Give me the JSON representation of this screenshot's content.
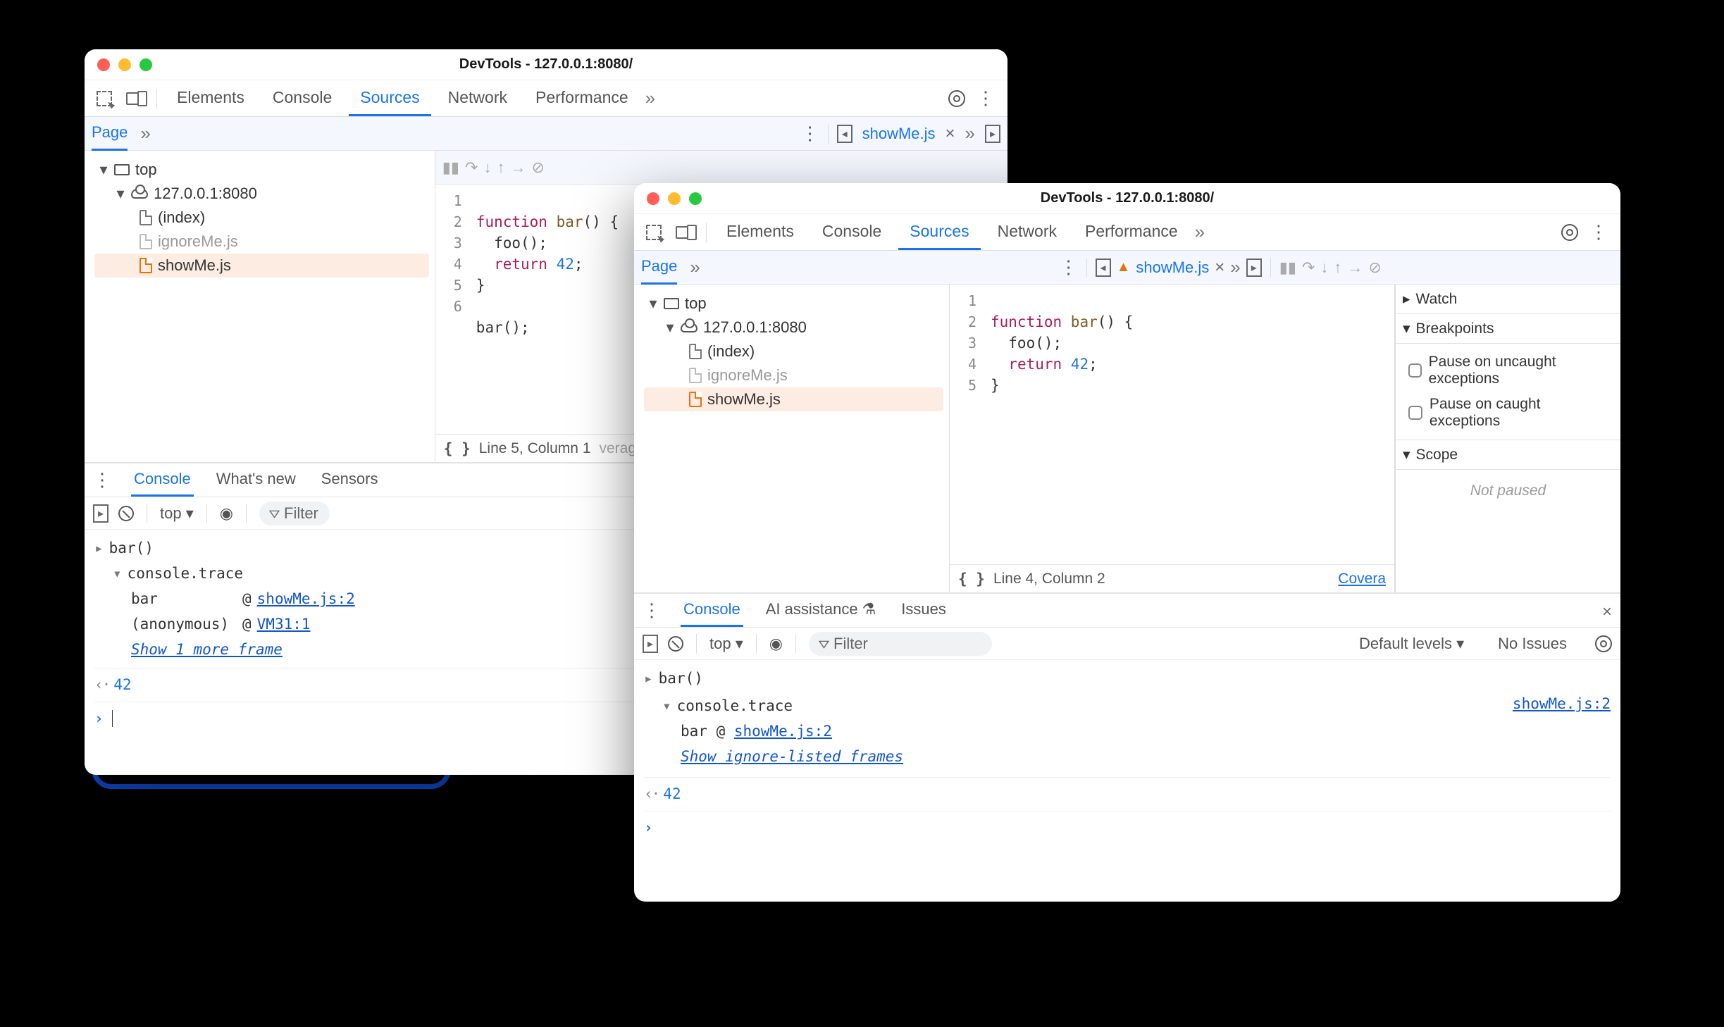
{
  "left": {
    "title": "DevTools - 127.0.0.1:8080/",
    "tabs": {
      "elements": "Elements",
      "console": "Console",
      "sources": "Sources",
      "network": "Network",
      "performance": "Performance",
      "active": "Sources"
    },
    "subbar": {
      "page": "Page",
      "openFile": "showMe.js"
    },
    "tree": {
      "top": "top",
      "origin": "127.0.0.1:8080",
      "index": "(index)",
      "ignore": "ignoreMe.js",
      "show": "showMe.js"
    },
    "code": {
      "lines": [
        "1",
        "2",
        "3",
        "4",
        "5",
        "6"
      ],
      "l1a": "function ",
      "l1b": "bar",
      "l1c": "() {",
      "l2": "  foo();",
      "l3a": "  ",
      "l3b": "return ",
      "l3c": "42",
      "l3d": ";",
      "l4": "}",
      "l5": "",
      "l6": "bar();"
    },
    "status": {
      "pretty": "{ }",
      "pos": "Line 5, Column 1",
      "extra": "verage:"
    },
    "drawerTabs": {
      "console": "Console",
      "whatsnew": "What's new",
      "sensors": "Sensors",
      "active": "Console"
    },
    "filter": {
      "ctx": "top ▾",
      "placeholder": "Filter"
    },
    "console": {
      "call": "bar()",
      "trace": "console.trace",
      "framebar": "bar",
      "frameanon": "(anonymous)",
      "at": "@",
      "loc1": "showMe.js:2",
      "loc2": "VM31:1",
      "showmore": "Show 1 more frame",
      "ret": "42"
    }
  },
  "right": {
    "title": "DevTools - 127.0.0.1:8080/",
    "tabs": {
      "elements": "Elements",
      "console": "Console",
      "sources": "Sources",
      "network": "Network",
      "performance": "Performance",
      "active": "Sources"
    },
    "subbar": {
      "page": "Page",
      "openFile": "showMe.js"
    },
    "tree": {
      "top": "top",
      "origin": "127.0.0.1:8080",
      "index": "(index)",
      "ignore": "ignoreMe.js",
      "show": "showMe.js"
    },
    "code": {
      "lines": [
        "1",
        "2",
        "3",
        "4",
        "5"
      ],
      "l1a": "function ",
      "l1b": "bar",
      "l1c": "() {",
      "l2": "  foo();",
      "l3a": "  ",
      "l3b": "return ",
      "l3c": "42",
      "l3d": ";",
      "l4": "}",
      "l5": ""
    },
    "status": {
      "pretty": "{ }",
      "pos": "Line 4, Column 2",
      "extra": "Covera"
    },
    "debugger": {
      "watch": "Watch",
      "breakpoints": "Breakpoints",
      "uncaught": "Pause on uncaught exceptions",
      "caught": "Pause on caught exceptions",
      "scope": "Scope",
      "notpaused": "Not paused"
    },
    "drawerTabs": {
      "console": "Console",
      "ai": "AI assistance",
      "issues": "Issues",
      "active": "Console"
    },
    "filter": {
      "ctx": "top ▾",
      "placeholder": "Filter",
      "levels": "Default levels ▾",
      "noissues": "No Issues"
    },
    "console": {
      "call": "bar()",
      "trace": "console.trace",
      "frame": "bar @ ",
      "loc": "showMe.js:2",
      "right_loc": "showMe.js:2",
      "showmore": "Show ignore-listed frames",
      "ret": "42"
    }
  }
}
